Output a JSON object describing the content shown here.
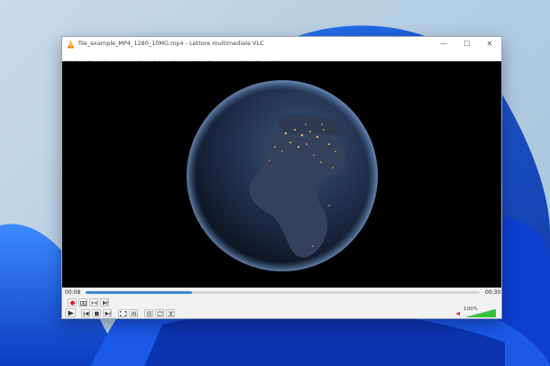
{
  "window": {
    "title": "file_example_MP4_1280_10MG.mp4 - Lettore multimediale VLC",
    "minimize_glyph": "—",
    "maximize_glyph": "☐",
    "close_glyph": "✕"
  },
  "menu": {
    "items": [
      "Media",
      "Riproduzione",
      "Audio",
      "Video",
      "Sottotitolo",
      "Strumenti",
      "Visualizza",
      "Aiuto"
    ]
  },
  "player": {
    "elapsed": "00:08",
    "duration": "00:30",
    "progress_fraction": 0.27,
    "volume_label": "100%",
    "volume_fraction": 1.0
  },
  "colors": {
    "accent": "#3f86d4",
    "record": "#e02020",
    "volume_green": "#33c43b",
    "vlc_orange": "#f28c00"
  },
  "icons": {
    "title": "vlc-cone-icon",
    "row1": [
      "record-icon",
      "snapshot-icon",
      "loop-ab-icon",
      "frame-step-icon"
    ],
    "row2": [
      "play-icon",
      "previous-icon",
      "stop-icon",
      "next-icon",
      "fullscreen-icon",
      "extended-settings-icon",
      "playlist-icon",
      "loop-icon",
      "shuffle-icon",
      "speaker-icon"
    ]
  }
}
